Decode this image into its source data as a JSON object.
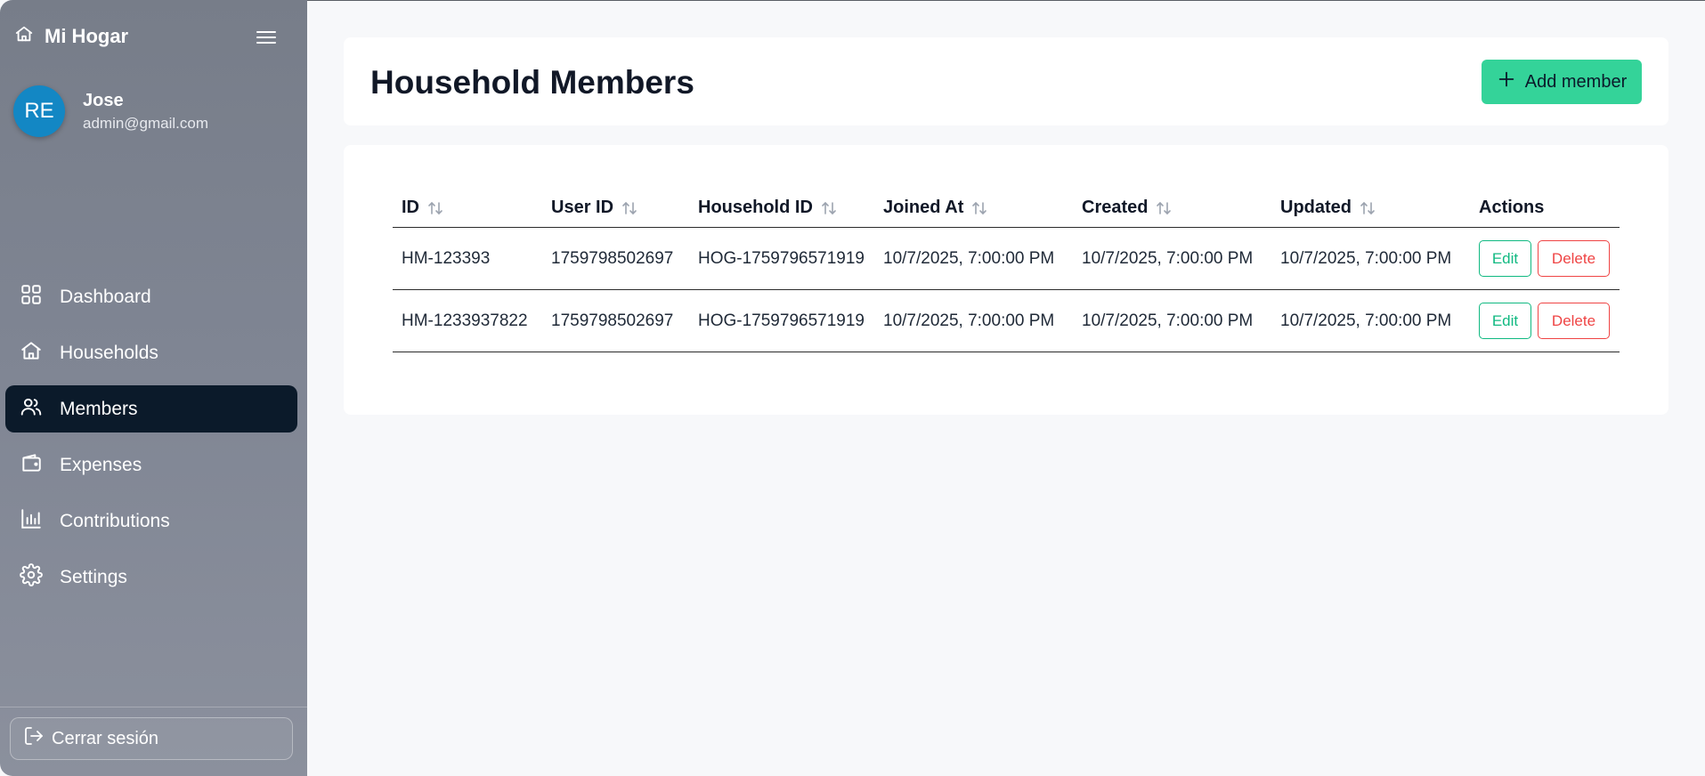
{
  "sidebar": {
    "brand": "Mi Hogar",
    "profile": {
      "initials": "RE",
      "name": "Jose",
      "email": "admin@gmail.com"
    },
    "items": [
      {
        "label": "Dashboard",
        "icon": "grid-icon",
        "active": false
      },
      {
        "label": "Households",
        "icon": "home-icon",
        "active": false
      },
      {
        "label": "Members",
        "icon": "users-icon",
        "active": true
      },
      {
        "label": "Expenses",
        "icon": "wallet-icon",
        "active": false
      },
      {
        "label": "Contributions",
        "icon": "bar-chart-icon",
        "active": false
      },
      {
        "label": "Settings",
        "icon": "gear-icon",
        "active": false
      }
    ],
    "logout_label": "Cerrar sesión"
  },
  "header": {
    "title": "Household Members",
    "add_button_label": "Add member"
  },
  "table": {
    "columns": [
      "ID",
      "User ID",
      "Household ID",
      "Joined At",
      "Created",
      "Updated",
      "Actions"
    ],
    "rows": [
      {
        "id": "HM-123393",
        "user_id": "1759798502697",
        "household_id": "HOG-1759796571919",
        "joined_at": "10/7/2025, 7:00:00 PM",
        "created": "10/7/2025, 7:00:00 PM",
        "updated": "10/7/2025, 7:00:00 PM"
      },
      {
        "id": "HM-1233937822",
        "user_id": "1759798502697",
        "household_id": "HOG-1759796571919",
        "joined_at": "10/7/2025, 7:00:00 PM",
        "created": "10/7/2025, 7:00:00 PM",
        "updated": "10/7/2025, 7:00:00 PM"
      }
    ],
    "edit_label": "Edit",
    "delete_label": "Delete"
  },
  "colors": {
    "accent": "#34d399",
    "active_nav": "#0b1a2a",
    "avatar": "#1387c4",
    "edit": "#10b981",
    "delete": "#ef4444"
  }
}
